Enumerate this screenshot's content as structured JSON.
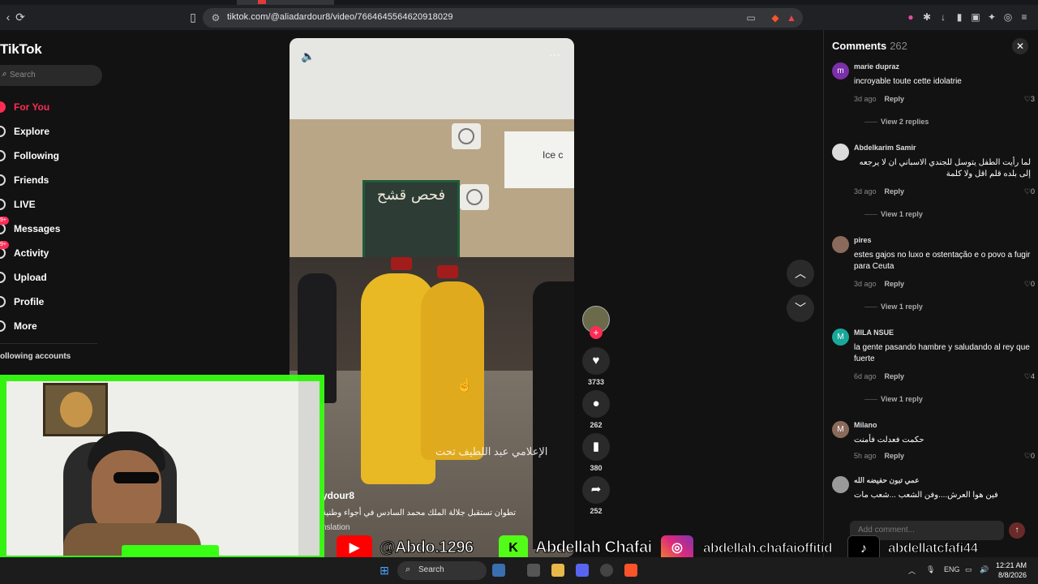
{
  "browser": {
    "url": "tiktok.com/@aliadardour8/video/7664645564620918029"
  },
  "sidebar": {
    "logo": "TikTok",
    "search_placeholder": "Search",
    "items": [
      {
        "label": "For You",
        "icon": "home-icon",
        "active": true
      },
      {
        "label": "Explore",
        "icon": "compass-icon"
      },
      {
        "label": "Following",
        "icon": "following-icon"
      },
      {
        "label": "Friends",
        "icon": "friends-icon"
      },
      {
        "label": "LIVE",
        "icon": "live-icon"
      },
      {
        "label": "Messages",
        "icon": "message-icon",
        "badge": "9+"
      },
      {
        "label": "Activity",
        "icon": "bell-icon",
        "badge": "9+"
      },
      {
        "label": "Upload",
        "icon": "upload-icon"
      },
      {
        "label": "Profile",
        "icon": "profile-icon"
      },
      {
        "label": "More",
        "icon": "more-icon"
      }
    ],
    "following_title": "ollowing accounts"
  },
  "video": {
    "author": "ydour8",
    "description": "تطوان تستقبل جلالة الملك محمد السادس في أجواء وطنية",
    "translation": "nslation",
    "overlay_caption": "الإعلامي عبد اللطيف تحت",
    "shop_sign": "فحص قشح",
    "store_text": "Ice c"
  },
  "actions": {
    "likes": "3733",
    "comments": "262",
    "saves": "380",
    "shares": "252"
  },
  "comments": {
    "title": "Comments",
    "count": "262",
    "input_placeholder": "Add comment...",
    "items": [
      {
        "name": "marie dupraz",
        "text": "incroyable toute cette idolatrie",
        "time": "3d ago",
        "reply": "Reply",
        "likes": "3",
        "replies": "View 2 replies",
        "avatar": "m",
        "color": "#7b2fa8"
      },
      {
        "name": "Abdelkarim Samir",
        "text": "لما رأيت الطفل يتوسل للجندي الاسباني ان لا يرجعه إلى بلده قلم اقل ولا كلمة",
        "time": "3d ago",
        "reply": "Reply",
        "likes": "0",
        "replies": "View 1 reply",
        "avatar": "",
        "color": "#dcdcdc"
      },
      {
        "name": "pires",
        "text": "estes gajos no luxo e ostentação e o povo a fugir para Ceuta",
        "time": "3d ago",
        "reply": "Reply",
        "likes": "0",
        "replies": "View 1 reply",
        "avatar": "",
        "color": "#8a6a5a"
      },
      {
        "name": "MILA NSUE",
        "text": "la gente pasando hambre y saludando al rey que fuerte",
        "time": "6d ago",
        "reply": "Reply",
        "likes": "4",
        "replies": "View 1 reply",
        "avatar": "M",
        "color": "#1aa89a"
      },
      {
        "name": "Milano",
        "text": "حكمت فعدلت فأمنت",
        "time": "5h ago",
        "reply": "Reply",
        "likes": "0",
        "replies": "",
        "avatar": "M",
        "color": "#8a6a5a"
      },
      {
        "name": "عمي تبون حفيضه الله",
        "text": "فين هوا العرش....وفن الشعب ...شعب مات",
        "time": "",
        "reply": "",
        "likes": "",
        "replies": "",
        "avatar": "",
        "color": "#9a9a9a"
      }
    ]
  },
  "social": {
    "youtube": "@Abdo.1296",
    "kick": "Abdellah Chafai",
    "instagram": "abdellah.chafaioffitid",
    "tiktok": "abdellatcfafi44"
  },
  "taskbar": {
    "search": "Search",
    "lang": "ENG",
    "time": "12:21 AM",
    "date": "8/8/2026"
  },
  "colors": {
    "accent": "#fe2c55",
    "webcam_border": "#39ff14"
  }
}
